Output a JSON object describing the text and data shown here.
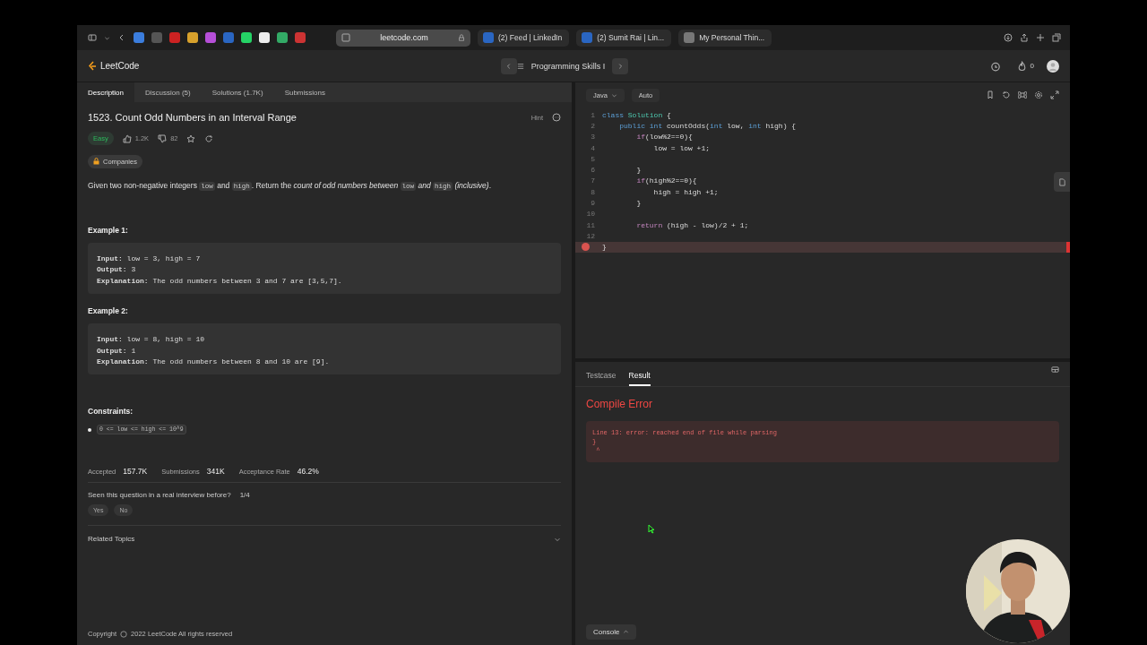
{
  "browser": {
    "url": "leetcode.com",
    "tabs": [
      {
        "title": "(2) Feed | LinkedIn"
      },
      {
        "title": "(2) Sumit Rai | Lin..."
      },
      {
        "title": "My Personal Thin..."
      }
    ]
  },
  "nav": {
    "logo": "LeetCode",
    "list_title": "Programming Skills I",
    "streak": "0"
  },
  "left_tabs": [
    {
      "label": "Description",
      "selected": true
    },
    {
      "label": "Discussion (5)",
      "selected": false
    },
    {
      "label": "Solutions (1.7K)",
      "selected": false
    },
    {
      "label": "Submissions",
      "selected": false
    }
  ],
  "problem": {
    "title": "1523. Count Odd Numbers in an Interval Range",
    "hint": "Hint",
    "difficulty": "Easy",
    "likes": "1.2K",
    "dislikes": "82",
    "companies": "Companies",
    "description": [
      {
        "kind": "text",
        "text": "Given two non-negative integers "
      },
      {
        "kind": "code",
        "text": "low"
      },
      {
        "kind": "text",
        "text": " and "
      },
      {
        "kind": "code",
        "text": "high"
      },
      {
        "kind": "text",
        "text": ". Return the "
      },
      {
        "kind": "italic",
        "text": "count of odd numbers between "
      },
      {
        "kind": "code",
        "text": "low"
      },
      {
        "kind": "italic",
        "text": " and "
      },
      {
        "kind": "code",
        "text": "high"
      },
      {
        "kind": "italic",
        "text": " (inclusive)"
      },
      {
        "kind": "text",
        "text": "."
      }
    ],
    "examples": [
      {
        "heading": "Example 1:",
        "lines": [
          "**Input:** low = 3, high = 7",
          "**Output:** 3",
          "**Explanation:** The odd numbers between 3 and 7 are [3,5,7]."
        ]
      },
      {
        "heading": "Example 2:",
        "lines": [
          "**Input:** low = 8, high = 10",
          "**Output:** 1",
          "**Explanation:** The odd numbers between 8 and 10 are [9]."
        ]
      }
    ],
    "constraints_heading": "Constraints:",
    "constraints": [
      "0 <= low <= high <= 10^9"
    ],
    "stats": [
      {
        "label": "Accepted",
        "value": "157.7K"
      },
      {
        "label": "Submissions",
        "value": "341K"
      },
      {
        "label": "Acceptance Rate",
        "value": "46.2%"
      }
    ],
    "interview": {
      "question": "Seen this question in a real interview before?",
      "count": "1/4",
      "buttons": [
        "Yes",
        "No"
      ]
    },
    "related_topics": "Related Topics",
    "copyright_label": "Copyright",
    "copyright_text": "2022 LeetCode All rights reserved"
  },
  "editor": {
    "language": "Java",
    "mode": "Auto",
    "lines": [
      {
        "number": "1",
        "error": false,
        "tokens": [
          {
            "kind": "type",
            "text": "class "
          },
          {
            "kind": "name",
            "text": "Solution"
          },
          {
            "kind": "plain",
            "text": " {"
          }
        ]
      },
      {
        "number": "2",
        "error": false,
        "tokens": [
          {
            "kind": "type",
            "text": "    public int "
          },
          {
            "kind": "plain",
            "text": "countOdds("
          },
          {
            "kind": "type",
            "text": "int"
          },
          {
            "kind": "plain",
            "text": " low, "
          },
          {
            "kind": "type",
            "text": "int"
          },
          {
            "kind": "plain",
            "text": " high) {"
          }
        ]
      },
      {
        "number": "3",
        "error": false,
        "tokens": [
          {
            "kind": "keyword",
            "text": "        if"
          },
          {
            "kind": "plain",
            "text": "(low%2==0){"
          }
        ]
      },
      {
        "number": "4",
        "error": false,
        "tokens": [
          {
            "kind": "plain",
            "text": "            low = low +1;"
          }
        ]
      },
      {
        "number": "5",
        "error": false
      },
      {
        "number": "6",
        "error": false,
        "tokens": [
          {
            "kind": "plain",
            "text": "        }"
          }
        ]
      },
      {
        "number": "7",
        "error": false,
        "tokens": [
          {
            "kind": "keyword",
            "text": "        if"
          },
          {
            "kind": "plain",
            "text": "(high%2==0){"
          }
        ]
      },
      {
        "number": "8",
        "error": false,
        "tokens": [
          {
            "kind": "plain",
            "text": "            high = high +1;"
          }
        ]
      },
      {
        "number": "9",
        "error": false,
        "tokens": [
          {
            "kind": "plain",
            "text": "        }"
          }
        ]
      },
      {
        "number": "10",
        "error": false
      },
      {
        "number": "11",
        "error": false,
        "tokens": [
          {
            "kind": "keyword",
            "text": "        return"
          },
          {
            "kind": "plain",
            "text": " (high - low)/2 + 1;"
          }
        ]
      },
      {
        "number": "12",
        "error": false
      },
      {
        "error": true,
        "tokens": [
          {
            "kind": "plain",
            "text": "}"
          }
        ]
      }
    ]
  },
  "result": {
    "tabs": [
      {
        "label": "Testcase",
        "selected": false
      },
      {
        "label": "Result",
        "selected": true
      }
    ],
    "status": "Compile Error",
    "error_lines": [
      "Line 13: error: reached end of file while parsing",
      "}",
      " ^"
    ],
    "console": "Console"
  }
}
